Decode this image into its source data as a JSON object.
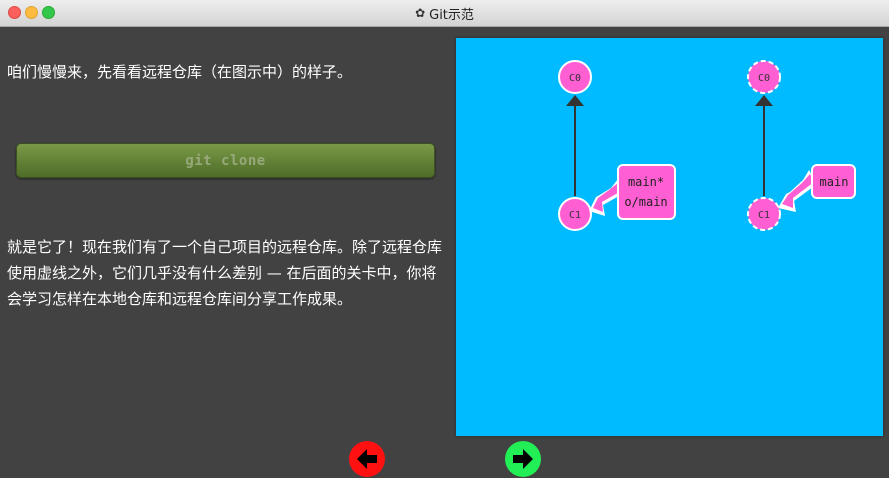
{
  "window": {
    "title": "Git示范",
    "title_icon": "gear-icon"
  },
  "intro_text": "咱们慢慢来，先看看远程仓库（在图示中）的样子。",
  "command_button": {
    "label": "git clone"
  },
  "body_text": "就是它了！现在我们有了一个自己项目的远程仓库。除了远程仓库使用虚线之外，它们几乎没有什么差别 — 在后面的关卡中，你将会学习怎样在本地仓库和远程仓库间分享工作成果。",
  "visualization": {
    "background_color": "#00bbff",
    "local_repo": {
      "commits": [
        "C0",
        "C1"
      ],
      "branch_label_line1": "main*",
      "branch_label_line2": "o/main"
    },
    "remote_repo": {
      "commits": [
        "C0",
        "C1"
      ],
      "branch_label": "main"
    },
    "commit_color": "#ff5fd2"
  },
  "navigation": {
    "prev_icon": "arrow-left-icon",
    "next_icon": "arrow-right-icon",
    "prev_color": "#ff1111",
    "next_color": "#22ee55"
  }
}
